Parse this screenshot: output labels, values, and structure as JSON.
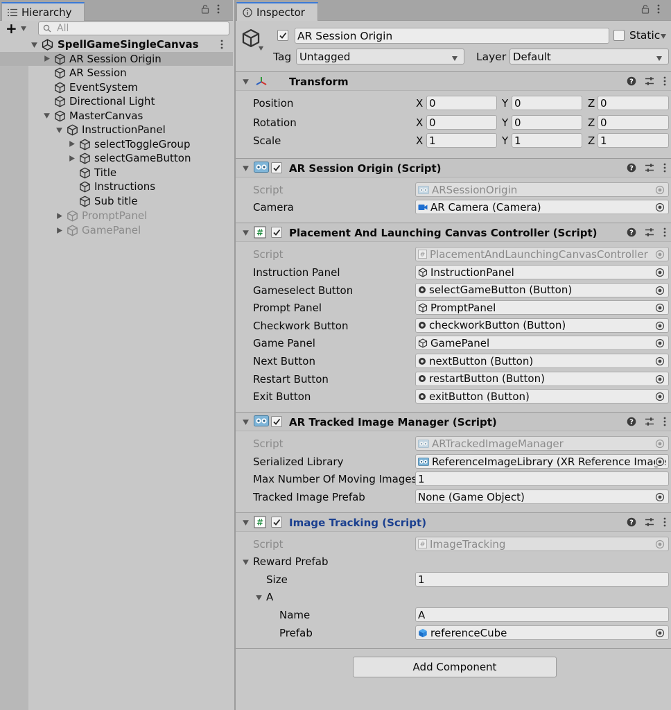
{
  "hierarchy": {
    "tab_label": "Hierarchy",
    "search_placeholder": "All",
    "add_label": "+",
    "rows": [
      {
        "label": "SpellGameSingleCanvas"
      },
      {
        "label": "AR Session Origin"
      },
      {
        "label": "AR Session"
      },
      {
        "label": "EventSystem"
      },
      {
        "label": "Directional Light"
      },
      {
        "label": "MasterCanvas"
      },
      {
        "label": "InstructionPanel"
      },
      {
        "label": "selectToggleGroup"
      },
      {
        "label": "selectGameButton"
      },
      {
        "label": "Title"
      },
      {
        "label": "Instructions"
      },
      {
        "label": "Sub title"
      },
      {
        "label": "PromptPanel"
      },
      {
        "label": "GamePanel"
      }
    ]
  },
  "inspector": {
    "tab_label": "Inspector",
    "object_name": "AR Session Origin",
    "static_label": "Static",
    "tag_label": "Tag",
    "tag_value": "Untagged",
    "layer_label": "Layer",
    "layer_value": "Default",
    "transform": {
      "title": "Transform",
      "position_label": "Position",
      "rotation_label": "Rotation",
      "scale_label": "Scale",
      "axis_x": "X",
      "axis_y": "Y",
      "axis_z": "Z",
      "position": [
        "0",
        "0",
        "0"
      ],
      "rotation": [
        "0",
        "0",
        "0"
      ],
      "scale": [
        "1",
        "1",
        "1"
      ]
    },
    "ar_session_origin": {
      "title": "AR Session Origin (Script)",
      "script_label": "Script",
      "script_value": "ARSessionOrigin",
      "camera_label": "Camera",
      "camera_value": "AR Camera (Camera)"
    },
    "placement": {
      "title": "Placement And Launching Canvas Controller (Script)",
      "script_label": "Script",
      "script_value": "PlacementAndLaunchingCanvasController",
      "props": [
        {
          "label": "Instruction Panel",
          "value": "InstructionPanel",
          "icon": "gameobject-icon"
        },
        {
          "label": "Gameselect Button",
          "value": "selectGameButton (Button)",
          "icon": "button-component-icon"
        },
        {
          "label": "Prompt Panel",
          "value": "PromptPanel",
          "icon": "gameobject-icon"
        },
        {
          "label": "Checkwork Button",
          "value": "checkworkButton (Button)",
          "icon": "button-component-icon"
        },
        {
          "label": "Game Panel",
          "value": "GamePanel",
          "icon": "gameobject-icon"
        },
        {
          "label": "Next Button",
          "value": "nextButton (Button)",
          "icon": "button-component-icon"
        },
        {
          "label": "Restart Button",
          "value": "restartButton (Button)",
          "icon": "button-component-icon"
        },
        {
          "label": "Exit Button",
          "value": "exitButton (Button)",
          "icon": "button-component-icon"
        }
      ]
    },
    "tracked_image_manager": {
      "title": "AR Tracked Image Manager (Script)",
      "script_label": "Script",
      "script_value": "ARTrackedImageManager",
      "library_label": "Serialized Library",
      "library_value": "ReferenceImageLibrary (XR Reference Image",
      "max_label": "Max Number Of Moving Images",
      "max_value": "1",
      "prefab_label": "Tracked Image Prefab",
      "prefab_value": "None (Game Object)"
    },
    "image_tracking": {
      "title": "Image Tracking (Script)",
      "title_color": "#1a3f8f",
      "script_label": "Script",
      "script_value": "ImageTracking",
      "reward_label": "Reward Prefab",
      "size_label": "Size",
      "size_value": "1",
      "element_label": "A",
      "name_label": "Name",
      "name_value": "A",
      "prefab_label": "Prefab",
      "prefab_value": "referenceCube"
    },
    "add_component_label": "Add Component"
  },
  "colors": {
    "panel_bg": "#c8c8c8",
    "tab_accent": "#3a79d6",
    "selection_bg": "#b0b0b0",
    "field_bg": "#ebebeb"
  }
}
